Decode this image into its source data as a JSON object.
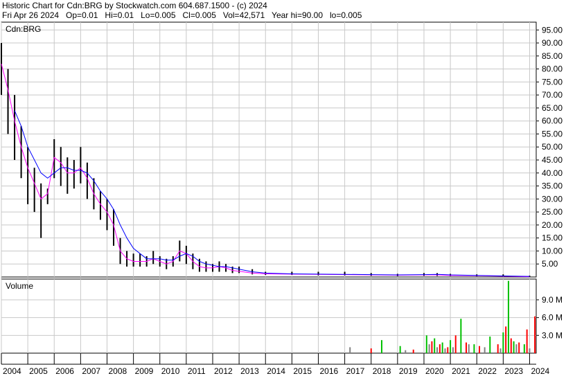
{
  "header": {
    "title": "Historic Chart for Cdn:BRG by Stockwatch.com 604.687.1500 - (c) 2024",
    "summary": "Fri Apr 26 2024   Op=0.01   Hi=0.01   Lo=0.005   Cl=0.005   Vol=42,571   Year hi=90.00   lo=0.005"
  },
  "chart_data": [
    {
      "panel": "price",
      "type": "line",
      "title": "Cdn:BRG",
      "xlabel": "",
      "ylabel": "",
      "x_ticks": [
        "2004",
        "2005",
        "2006",
        "2007",
        "2008",
        "2009",
        "2010",
        "2011",
        "2012",
        "2013",
        "2014",
        "2015",
        "2016",
        "2017",
        "2018",
        "2019",
        "2020",
        "2021",
        "2022",
        "2023",
        "2024"
      ],
      "y_ticks": [
        "5.00",
        "10.00",
        "15.00",
        "20.00",
        "25.00",
        "30.00",
        "35.00",
        "40.00",
        "45.00",
        "50.00",
        "55.00",
        "60.00",
        "65.00",
        "70.00",
        "75.00",
        "80.00",
        "85.00",
        "90.00",
        "95.00"
      ],
      "ylim": [
        0,
        98
      ],
      "grid": true,
      "series": [
        {
          "style": "hi-lo bars",
          "color": "#000000",
          "x": [
            2004.0,
            2004.25,
            2004.5,
            2004.75,
            2005.0,
            2005.25,
            2005.5,
            2005.75,
            2006.0,
            2006.25,
            2006.5,
            2006.75,
            2007.0,
            2007.25,
            2007.5,
            2007.75,
            2008.0,
            2008.25,
            2008.5,
            2008.75,
            2009.0,
            2009.25,
            2009.5,
            2009.75,
            2010.0,
            2010.25,
            2010.5,
            2010.75,
            2011.0,
            2011.25,
            2011.5,
            2011.75,
            2012.0,
            2012.25,
            2012.5,
            2012.75,
            2013.0,
            2013.5,
            2014.0,
            2015.0,
            2016.0,
            2017.0,
            2018.0,
            2019.0,
            2020.0,
            2020.5,
            2021.0,
            2022.0,
            2023.0,
            2024.0
          ],
          "high": [
            90,
            80,
            70,
            58,
            50,
            42,
            36,
            34,
            53,
            50,
            46,
            45,
            50,
            44,
            38,
            33,
            30,
            26,
            15,
            10,
            9,
            9,
            8,
            10,
            8,
            7,
            8,
            14,
            12,
            9,
            7,
            6,
            5,
            6,
            5,
            4,
            4,
            3,
            2,
            2,
            2,
            2,
            1.5,
            1.2,
            1.5,
            1.5,
            1.2,
            1,
            1,
            0.5
          ],
          "low": [
            70,
            55,
            45,
            38,
            28,
            25,
            15,
            28,
            38,
            35,
            32,
            34,
            36,
            30,
            26,
            22,
            18,
            12,
            5,
            4,
            4,
            4,
            4,
            5,
            4,
            3,
            4,
            6,
            5,
            3,
            2,
            2,
            2,
            2,
            2,
            1.5,
            1.5,
            1,
            0.8,
            0.8,
            0.6,
            0.6,
            0.4,
            0.3,
            0.4,
            0.4,
            0.3,
            0.2,
            0.1,
            0.01
          ]
        },
        {
          "style": "short moving average",
          "color": "#ff00ff",
          "x": [
            2004.0,
            2004.25,
            2004.5,
            2004.75,
            2005.0,
            2005.25,
            2005.5,
            2005.75,
            2006.0,
            2006.25,
            2006.5,
            2006.75,
            2007.0,
            2007.25,
            2007.5,
            2007.75,
            2008.0,
            2008.25,
            2008.5,
            2008.75,
            2009.0,
            2009.25,
            2009.5,
            2009.75,
            2010.0,
            2010.25,
            2010.5,
            2010.75,
            2011.0,
            2011.25,
            2011.5,
            2011.75,
            2012.0,
            2012.25,
            2012.5,
            2012.75,
            2013.0,
            2013.5,
            2014.0,
            2015.0,
            2016.0,
            2017.0,
            2018.0,
            2019.0,
            2020.0,
            2020.5,
            2021.0,
            2022.0,
            2023.0,
            2024.0
          ],
          "values": [
            82,
            72,
            60,
            50,
            42,
            36,
            30,
            32,
            46,
            44,
            40,
            40,
            42,
            38,
            32,
            28,
            25,
            20,
            10,
            7,
            6,
            6,
            6,
            7,
            6,
            5,
            6,
            10,
            9,
            6,
            4,
            3.5,
            3.5,
            4,
            3.5,
            2.5,
            2.2,
            1.5,
            1.2,
            1.1,
            1,
            0.9,
            0.8,
            0.7,
            0.8,
            0.8,
            0.6,
            0.5,
            0.3,
            0.1
          ]
        },
        {
          "style": "long moving average",
          "color": "#0000ff",
          "x": [
            2004.5,
            2004.75,
            2005.0,
            2005.25,
            2005.5,
            2005.75,
            2006.0,
            2006.25,
            2006.5,
            2006.75,
            2007.0,
            2007.25,
            2007.5,
            2007.75,
            2008.0,
            2008.25,
            2008.5,
            2008.75,
            2009.0,
            2009.25,
            2009.5,
            2009.75,
            2010.0,
            2010.25,
            2010.5,
            2010.75,
            2011.0,
            2011.25,
            2011.5,
            2011.75,
            2012.0,
            2012.25,
            2012.5,
            2012.75,
            2013.0,
            2013.5,
            2014.0,
            2015.0,
            2016.0,
            2017.0,
            2018.0,
            2019.0,
            2020.0,
            2020.5,
            2021.0,
            2022.0,
            2023.0,
            2024.0
          ],
          "values": [
            64,
            58,
            50,
            45,
            40,
            38,
            40,
            42,
            42,
            41,
            41,
            40,
            37,
            33,
            30,
            26,
            20,
            15,
            11,
            9,
            7,
            7,
            7,
            6.5,
            6.5,
            8,
            9,
            8,
            6,
            5,
            4.5,
            4,
            4,
            3.5,
            3,
            2,
            1.5,
            1.2,
            1.1,
            1,
            0.9,
            0.8,
            0.9,
            1,
            0.8,
            0.6,
            0.4,
            0.2
          ]
        }
      ]
    },
    {
      "panel": "volume",
      "type": "bar",
      "title": "Volume",
      "y_ticks": [
        "3.0 M",
        "6.0 M",
        "9.0 M"
      ],
      "ylim": [
        0,
        12.5
      ],
      "grid": true,
      "series": [
        {
          "name": "",
          "color": "#00c000",
          "x": [
            2018.4,
            2019.1,
            2020.1,
            2020.4,
            2020.7,
            2021.0,
            2021.4,
            2021.9,
            2022.5,
            2023.0,
            2023.2,
            2023.4,
            2023.8
          ],
          "values": [
            2.2,
            1.2,
            3.0,
            2.5,
            1.8,
            2.2,
            5.8,
            1.5,
            2.8,
            3.5,
            12.2,
            2.0,
            1.5
          ]
        },
        {
          "name": "",
          "color": "#ff0000",
          "x": [
            2018.0,
            2019.6,
            2020.3,
            2020.6,
            2020.9,
            2021.2,
            2021.6,
            2022.1,
            2022.8,
            2023.1,
            2023.3,
            2023.6,
            2023.9,
            2024.2
          ],
          "values": [
            0.8,
            0.6,
            2.0,
            1.5,
            1.0,
            3.0,
            1.8,
            1.2,
            1.5,
            4.5,
            2.5,
            1.8,
            4.0,
            6.2
          ]
        },
        {
          "name": "",
          "color": "#808080",
          "x": [
            2017.2,
            2019.3,
            2020.2,
            2020.5,
            2020.8,
            2021.1,
            2021.7,
            2022.3,
            2022.9,
            2023.5,
            2024.0
          ],
          "values": [
            1.0,
            0.5,
            1.5,
            1.0,
            0.8,
            1.0,
            1.5,
            1.0,
            0.8,
            1.5,
            0.8
          ]
        }
      ]
    }
  ]
}
